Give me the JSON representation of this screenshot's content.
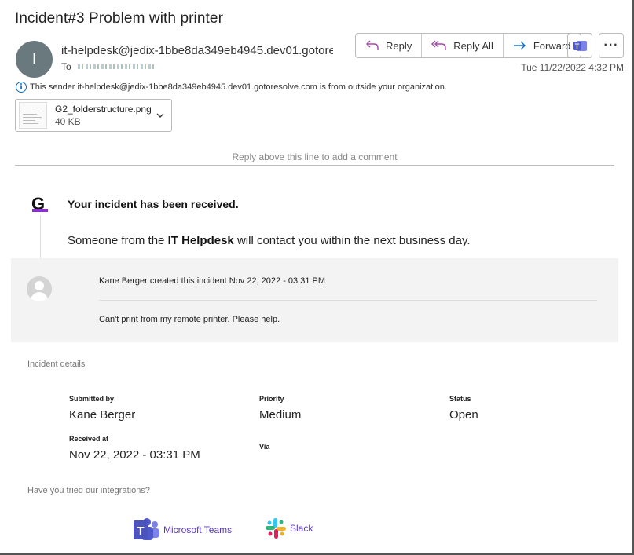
{
  "email": {
    "subject": "Incident#3 Problem with printer",
    "avatar_initial": "I",
    "sender": "it-helpdesk@jedix-1bbe8da349eb4945.dev01.gotoresolve.com",
    "to_label": "To",
    "date": "Tue 11/22/2022 4:32 PM",
    "outside_notice": "This sender it-helpdesk@jedix-1bbe8da349eb4945.dev01.gotoresolve.com is from outside your organization."
  },
  "actions": {
    "reply": "Reply",
    "reply_all": "Reply All",
    "forward": "Forward"
  },
  "attachment": {
    "name": "G2_folderstructure.png",
    "size": "40 KB"
  },
  "body": {
    "reply_above": "Reply above this line to add a comment",
    "logo_letter": "G",
    "received": "Your incident has been received.",
    "contact_prefix": "Someone from the ",
    "contact_bold": "IT Helpdesk",
    "contact_suffix": " will contact you within the next business day.",
    "created": "Kane Berger created this incident Nov 22, 2022 - 03:31 PM",
    "comment": "Can't print from my remote printer. Please help."
  },
  "details": {
    "heading": "Incident details",
    "submitted_by_label": "Submitted by",
    "submitted_by": "Kane Berger",
    "priority_label": "Priority",
    "priority": "Medium",
    "status_label": "Status",
    "status": "Open",
    "received_at_label": "Received at",
    "received_at": "Nov 22, 2022 - 03:31 PM",
    "via_label": "Via"
  },
  "integrations": {
    "heading": "Have you tried our integrations?",
    "teams": "Microsoft Teams",
    "slack": "Slack"
  },
  "colors": {
    "accent_purple": "#8b2fd0",
    "teams_purple": "#5059c9",
    "link_purple": "#5b37c8"
  }
}
